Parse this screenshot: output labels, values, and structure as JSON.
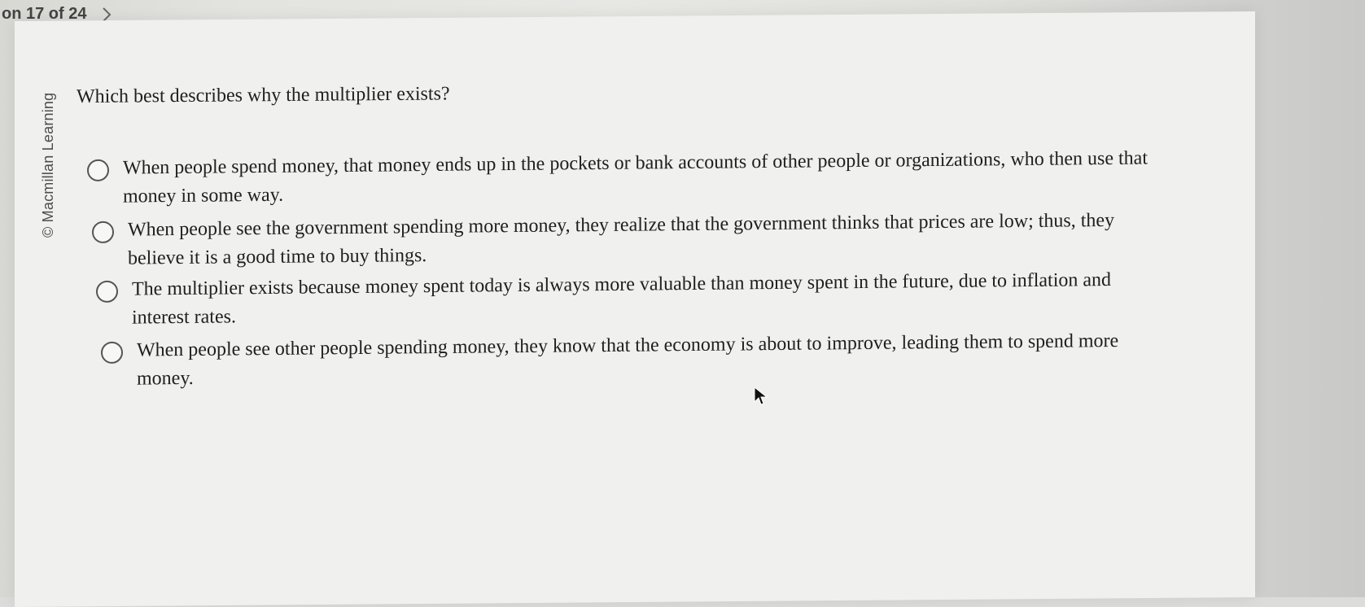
{
  "nav": {
    "counter": "on 17 of 24",
    "next_icon": "chevron-right-icon"
  },
  "sidebar": {
    "copyright": "© Macmillan Learning"
  },
  "question": {
    "text": "Which best describes why the multiplier exists?",
    "options": [
      {
        "label": "When people spend money, that money ends up in the pockets or bank accounts of other people or organizations, who then use that money in some way.",
        "selected": false
      },
      {
        "label": "When people see the government spending more money, they realize that the government thinks that prices are low; thus, they believe it is a good time to buy things.",
        "selected": false
      },
      {
        "label": "The multiplier exists because money spent today is always more valuable than money spent in the future, due to inflation and interest rates.",
        "selected": false
      },
      {
        "label": "When people see other people spending money, they know that the economy is about to improve, leading them to spend more money.",
        "selected": false
      }
    ]
  },
  "pointer": {
    "icon": "mouse-cursor-icon"
  }
}
